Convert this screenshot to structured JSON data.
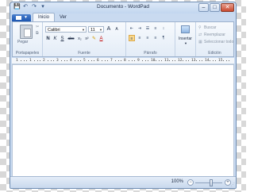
{
  "window": {
    "title": "Documento - WordPad",
    "buttons": {
      "minimize": "–",
      "maximize": "□",
      "close": "✕"
    }
  },
  "quick_access": {
    "save_icon": "💾",
    "undo_icon": "↶",
    "redo_icon": "↷",
    "more_icon": "▾"
  },
  "tabs": [
    {
      "label": "Inicio",
      "active": true
    },
    {
      "label": "Ver",
      "active": false
    }
  ],
  "ribbon": {
    "clipboard": {
      "paste": "Pegar",
      "group": "Portapapeles",
      "cut_icon": "✂",
      "copy_icon": "⧉"
    },
    "font": {
      "family": "Calibri",
      "size": "11",
      "grow": "A",
      "shrink": "A",
      "bold": "N",
      "italic": "K",
      "underline": "S",
      "strike": "abc",
      "subscript": "x₂",
      "superscript": "x²",
      "highlight": "✎",
      "color": "A",
      "group": "Fuente"
    },
    "paragraph": {
      "row1": [
        "⇤",
        "⇥",
        "☰",
        "≡",
        "↕"
      ],
      "row2": [
        "≡",
        "≡",
        "≡",
        "≡",
        "¶"
      ],
      "group": "Párrafo"
    },
    "insert": {
      "label": "Insertar"
    },
    "editing": {
      "find": "Buscar",
      "replace": "Reemplazar",
      "select_all": "Seleccionar todo",
      "group": "Edición"
    }
  },
  "ruler": {
    "numbers": [
      "1",
      "1",
      "2",
      "3",
      "4",
      "5",
      "6",
      "7",
      "8",
      "9",
      "10",
      "11",
      "12",
      "13",
      "14",
      "15"
    ]
  },
  "status": {
    "zoom": "100%",
    "minus": "−",
    "plus": "+"
  }
}
